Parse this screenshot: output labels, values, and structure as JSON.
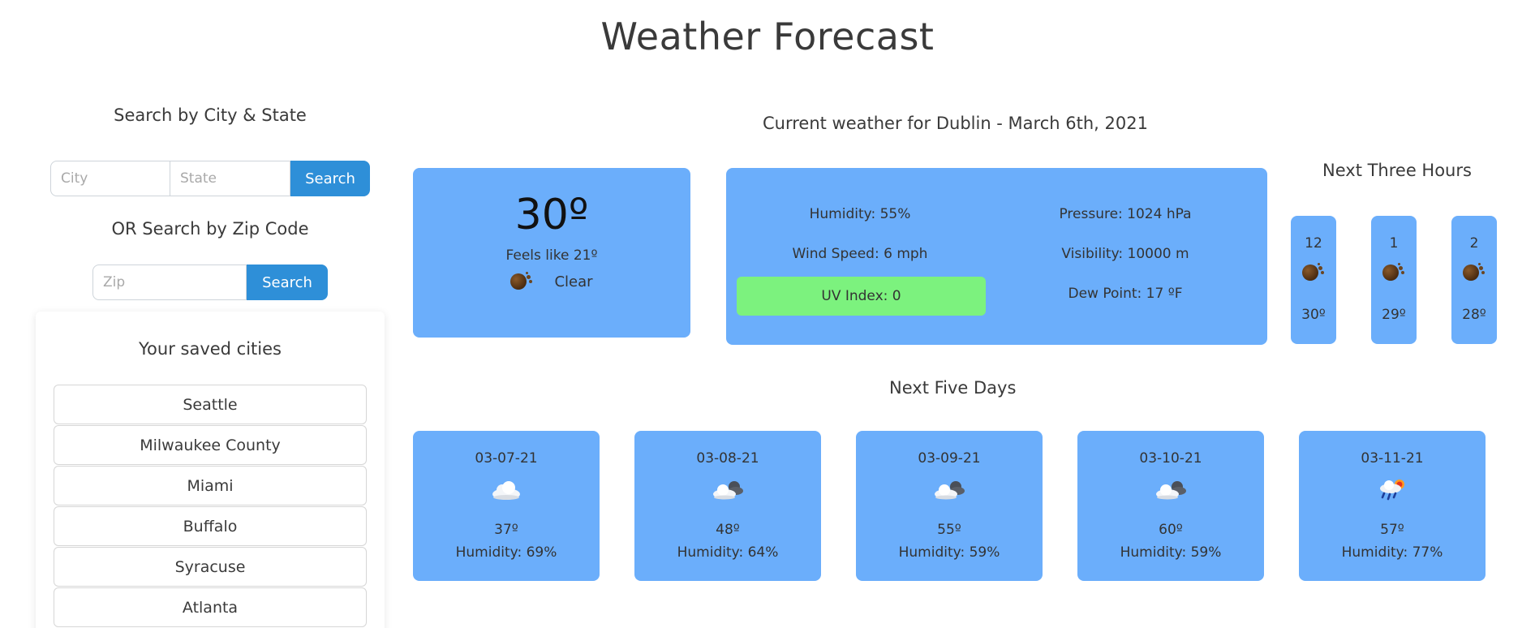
{
  "page": {
    "title": "Weather Forecast"
  },
  "sidebar": {
    "city_search_title": "Search by City & State",
    "city_placeholder": "City",
    "state_placeholder": "State",
    "search_label": "Search",
    "zip_search_title": "OR Search by Zip Code",
    "zip_placeholder": "Zip",
    "zip_search_label": "Search",
    "saved_title": "Your saved cities",
    "saved_cities": [
      "Seattle",
      "Milwaukee County",
      "Miami",
      "Buffalo",
      "Syracuse",
      "Atlanta"
    ]
  },
  "current": {
    "heading": "Current weather for Dublin - March 6th, 2021",
    "temp": "30º",
    "feels_like": "Feels like 21º",
    "condition": "Clear",
    "condition_icon": "moon-icon",
    "humidity": "Humidity: 55%",
    "pressure": "Pressure: 1024 hPa",
    "wind": "Wind Speed: 6 mph",
    "visibility": "Visibility: 10000 m",
    "uv": "UV Index: 0",
    "dew_point": "Dew Point: 17 ºF",
    "uv_color": "#7cf27e",
    "card_color": "#6baefb"
  },
  "next_three_hours": {
    "title": "Next Three Hours",
    "hours": [
      {
        "time": "12",
        "temp": "30º",
        "icon": "moon-icon"
      },
      {
        "time": "1",
        "temp": "29º",
        "icon": "moon-icon"
      },
      {
        "time": "2",
        "temp": "28º",
        "icon": "moon-icon"
      }
    ]
  },
  "next_five_days": {
    "title": "Next Five Days",
    "days": [
      {
        "date": "03-07-21",
        "temp": "37º",
        "humidity": "Humidity: 69%",
        "icon": "cloud-icon"
      },
      {
        "date": "03-08-21",
        "temp": "48º",
        "humidity": "Humidity: 64%",
        "icon": "clouds-icon"
      },
      {
        "date": "03-09-21",
        "temp": "55º",
        "humidity": "Humidity: 59%",
        "icon": "clouds-icon"
      },
      {
        "date": "03-10-21",
        "temp": "60º",
        "humidity": "Humidity: 59%",
        "icon": "clouds-icon"
      },
      {
        "date": "03-11-21",
        "temp": "57º",
        "humidity": "Humidity: 77%",
        "icon": "rain-sun-icon"
      }
    ]
  }
}
